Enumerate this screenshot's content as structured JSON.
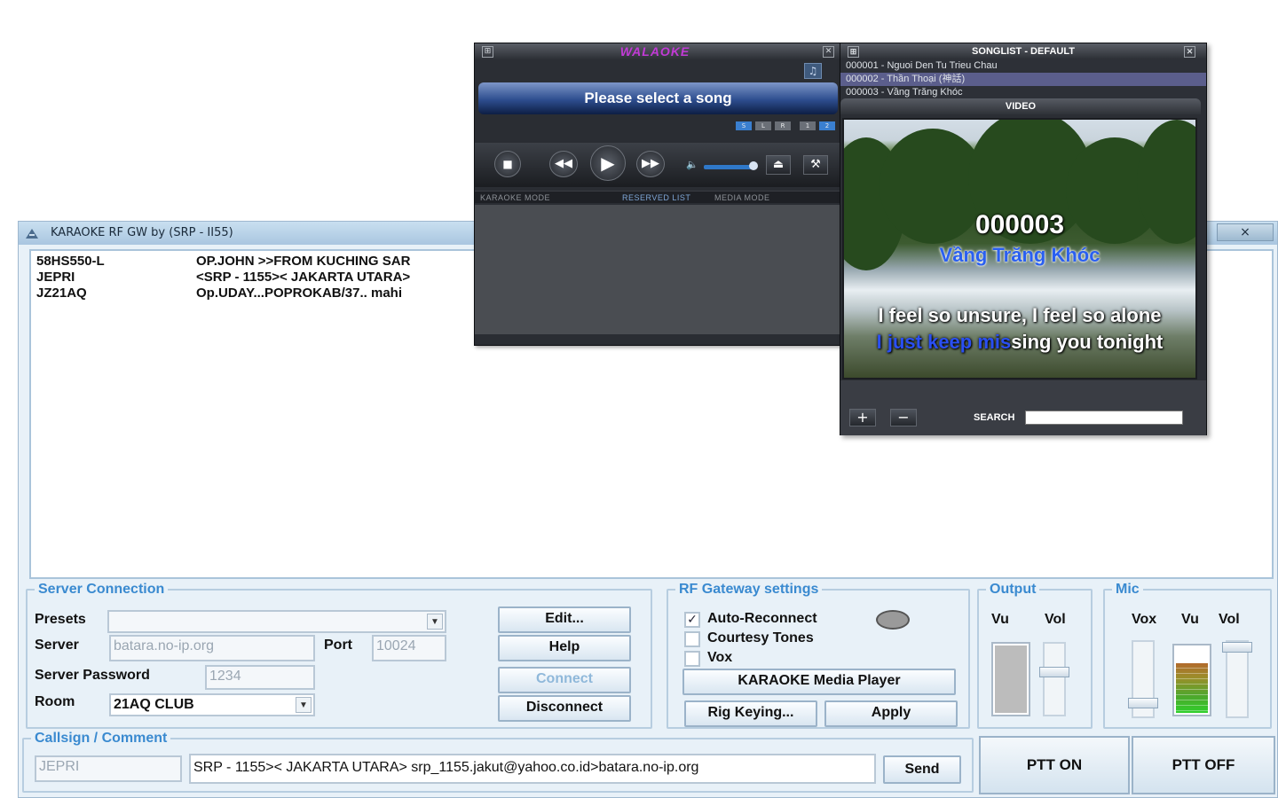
{
  "main_window": {
    "title": "KARAOKE RF GW  by (SRP - II55)",
    "close_label": "×"
  },
  "log": [
    {
      "callsign": "58HS550-L",
      "message": "OP.JOHN >>FROM KUCHING SAR"
    },
    {
      "callsign": "JEPRI",
      "message": "<SRP - 1155>< JAKARTA UTARA>"
    },
    {
      "callsign": "JZ21AQ",
      "message": "Op.UDAY...POPROKAB/37.. mahi"
    }
  ],
  "server_connection": {
    "title": "Server Connection",
    "presets_label": "Presets",
    "presets_value": "",
    "server_label": "Server",
    "server_value": "batara.no-ip.org",
    "port_label": "Port",
    "port_value": "10024",
    "password_label": "Server  Password",
    "password_value": "1234",
    "room_label": "Room",
    "room_value": "21AQ CLUB",
    "edit_button": "Edit...",
    "help_button": "Help",
    "connect_button": "Connect",
    "disconnect_button": "Disconnect"
  },
  "rf_gateway": {
    "title": "RF Gateway settings",
    "auto_reconnect_label": "Auto-Reconnect",
    "auto_reconnect_checked": true,
    "courtesy_tones_label": "Courtesy Tones",
    "courtesy_tones_checked": false,
    "vox_label": "Vox",
    "vox_checked": false,
    "media_player_button": "KARAOKE Media Player",
    "rig_keying_button": "Rig Keying...",
    "apply_button": "Apply",
    "status_led_color": "#9a9a9a"
  },
  "output": {
    "title": "Output",
    "vu_label": "Vu",
    "vol_label": "Vol",
    "vu_level": 1.0,
    "vol_level": 0.6
  },
  "mic": {
    "title": "Mic",
    "vox_label": "Vox",
    "vu_label": "Vu",
    "vol_label": "Vol",
    "vox_level": 0.1,
    "vu_level": 0.75,
    "vol_level": 1.0
  },
  "callsign_comment": {
    "title": "Callsign / Comment",
    "callsign_value": "JEPRI",
    "comment_value": "SRP - 1155>< JAKARTA UTARA> srp_1155.jakut@yahoo.co.id>batara.no-ip.org",
    "send_button": "Send"
  },
  "ptt": {
    "on_label": "PTT ON",
    "off_label": "PTT OFF"
  },
  "player": {
    "logo": "WALAOKE",
    "now_playing": "Please select a song",
    "mini_buttons": [
      "S",
      "L",
      "R",
      "1",
      "2"
    ],
    "tabs": [
      "KARAOKE MODE",
      "RESERVED LIST",
      "MEDIA MODE"
    ],
    "volume_level": 0.95,
    "accent_color": "#3a7fd0"
  },
  "songlist": {
    "title": "SONGLIST - DEFAULT",
    "songs": [
      "000001 - Nguoi Den Tu Trieu Chau",
      "000002 - Thần Thoại (神話)",
      "000003 - Vầng Trăng Khóc"
    ],
    "selected_index": 1,
    "video_label": "VIDEO",
    "video_number": "000003",
    "video_title": "Vầng Trăng Khóc",
    "lyric_line1": "I feel so unsure, I feel so alone",
    "lyric_line2_sung": "I just keep mis",
    "lyric_line2_rest": "sing you tonight",
    "search_label": "SEARCH",
    "search_value": "",
    "add_button": "+",
    "remove_button": "−"
  }
}
